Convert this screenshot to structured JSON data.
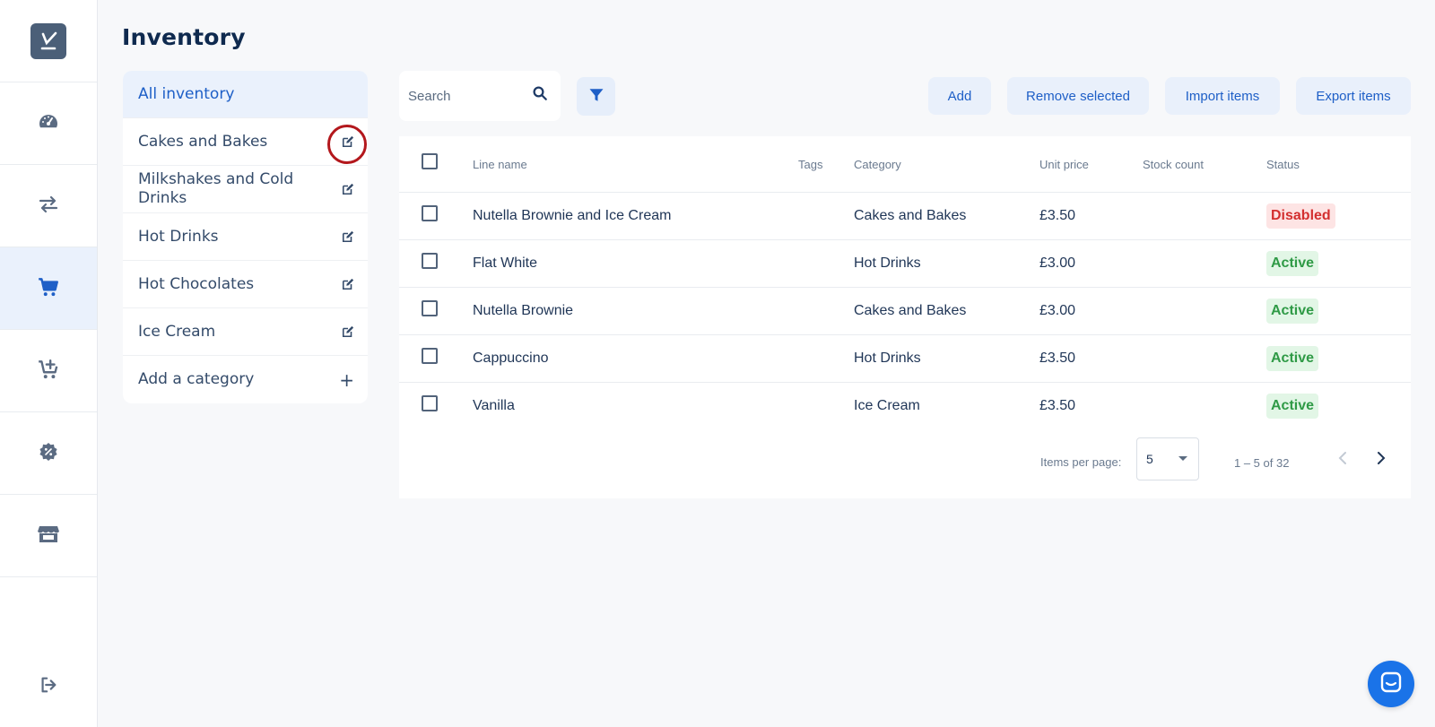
{
  "page": {
    "title": "Inventory"
  },
  "sidebar": {
    "items": [
      {
        "icon": "dashboard-gauge-icon",
        "active": false
      },
      {
        "icon": "transfer-arrows-icon",
        "active": false
      },
      {
        "icon": "shopping-cart-icon",
        "active": true
      },
      {
        "icon": "cart-add-icon",
        "active": false
      },
      {
        "icon": "discount-badge-icon",
        "active": false
      },
      {
        "icon": "store-icon",
        "active": false
      }
    ],
    "logout_icon": "logout-icon"
  },
  "categories": {
    "all_label": "All inventory",
    "items": [
      {
        "label": "Cakes and Bakes"
      },
      {
        "label": "Milkshakes and Cold Drinks"
      },
      {
        "label": "Hot Drinks"
      },
      {
        "label": "Hot Chocolates"
      },
      {
        "label": "Ice Cream"
      }
    ],
    "add_label": "Add a category"
  },
  "toolbar": {
    "search_placeholder": "Search",
    "add_label": "Add",
    "remove_label": "Remove selected",
    "import_label": "Import items",
    "export_label": "Export items"
  },
  "table": {
    "headers": {
      "line_name": "Line name",
      "tags": "Tags",
      "category": "Category",
      "unit_price": "Unit price",
      "stock_count": "Stock count",
      "status": "Status"
    },
    "rows": [
      {
        "name": "Nutella Brownie and Ice Cream",
        "tags": "",
        "category": "Cakes and Bakes",
        "price": "£3.50",
        "stock": "",
        "status": "Disabled"
      },
      {
        "name": "Flat White",
        "tags": "",
        "category": "Hot Drinks",
        "price": "£3.00",
        "stock": "",
        "status": "Active"
      },
      {
        "name": "Nutella Brownie",
        "tags": "",
        "category": "Cakes and Bakes",
        "price": "£3.00",
        "stock": "",
        "status": "Active"
      },
      {
        "name": "Cappuccino",
        "tags": "",
        "category": "Hot Drinks",
        "price": "£3.50",
        "stock": "",
        "status": "Active"
      },
      {
        "name": "Vanilla",
        "tags": "",
        "category": "Ice Cream",
        "price": "£3.50",
        "stock": "",
        "status": "Active"
      }
    ]
  },
  "pagination": {
    "items_per_page_label": "Items per page:",
    "items_per_page_value": "5",
    "range_label": "1 – 5 of 32"
  },
  "colors": {
    "accent": "#1e5fc7",
    "status_disabled": "#d32f2f",
    "status_active": "#2f9a46",
    "highlight_ring": "#b3171c"
  }
}
